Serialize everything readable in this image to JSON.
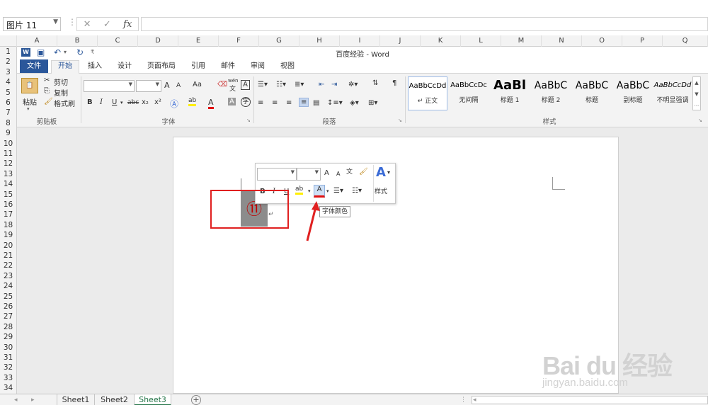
{
  "formula_bar": {
    "name_box": "图片 11",
    "cancel_icon": "✕",
    "enter_icon": "✓",
    "fx_label": "fx",
    "formula": ""
  },
  "columns": [
    "A",
    "B",
    "C",
    "D",
    "E",
    "F",
    "G",
    "H",
    "I",
    "J",
    "K",
    "L",
    "M",
    "N",
    "O",
    "P",
    "Q"
  ],
  "rows": [
    "1",
    "2",
    "3",
    "4",
    "5",
    "6",
    "7",
    "8",
    "9",
    "10",
    "11",
    "12",
    "13",
    "14",
    "15",
    "16",
    "17",
    "18",
    "19",
    "20",
    "21",
    "22",
    "23",
    "24",
    "25",
    "26",
    "27",
    "28",
    "29",
    "30",
    "31",
    "32",
    "33",
    "34"
  ],
  "word": {
    "title": "百度经验 - Word",
    "tabs": [
      "文件",
      "开始",
      "插入",
      "设计",
      "页面布局",
      "引用",
      "邮件",
      "审阅",
      "视图"
    ],
    "clipboard": {
      "paste": "粘贴",
      "cut": "剪切",
      "copy": "复制",
      "format_painter": "格式刷",
      "label": "剪贴板"
    },
    "font_group_label": "字体",
    "paragraph_group_label": "段落",
    "styles_group_label": "样式",
    "styles": [
      {
        "preview": "AaBbCcDd",
        "name": "↵ 正文"
      },
      {
        "preview": "AaBbCcDc",
        "name": "无间隔"
      },
      {
        "preview": "AaBl",
        "name": "标题 1"
      },
      {
        "preview": "AaBbC",
        "name": "标题 2"
      },
      {
        "preview": "AaBbC",
        "name": "标题"
      },
      {
        "preview": "AaBbC",
        "name": "副标题"
      },
      {
        "preview": "AaBbCcDd",
        "name": "不明显强调"
      }
    ],
    "font_buttons": {
      "grow": "A",
      "shrink": "A",
      "case": "Aa",
      "phonetic": "wén",
      "phonetic_char": "文",
      "border_char": "A",
      "bold": "B",
      "italic": "I",
      "underline": "U",
      "strike": "abc",
      "subscript": "x₂",
      "superscript": "x²",
      "color": "A"
    }
  },
  "document": {
    "circled_number": "⑪",
    "return_mark": "↵",
    "tooltip": "字体颜色",
    "mini_toolbar": {
      "styles_label": "样式",
      "bold": "B",
      "italic": "I",
      "underline": "U",
      "font_color": "A"
    }
  },
  "sheets": [
    "Sheet1",
    "Sheet2",
    "Sheet3"
  ],
  "active_sheet": "Sheet3",
  "watermark": {
    "logo": "Bai du 经验",
    "url": "jingyan.baidu.com"
  },
  "colors": {
    "word_blue": "#2b579a",
    "excel_green": "#217346",
    "highlight_red": "#e02020",
    "font_red": "#c00000"
  }
}
